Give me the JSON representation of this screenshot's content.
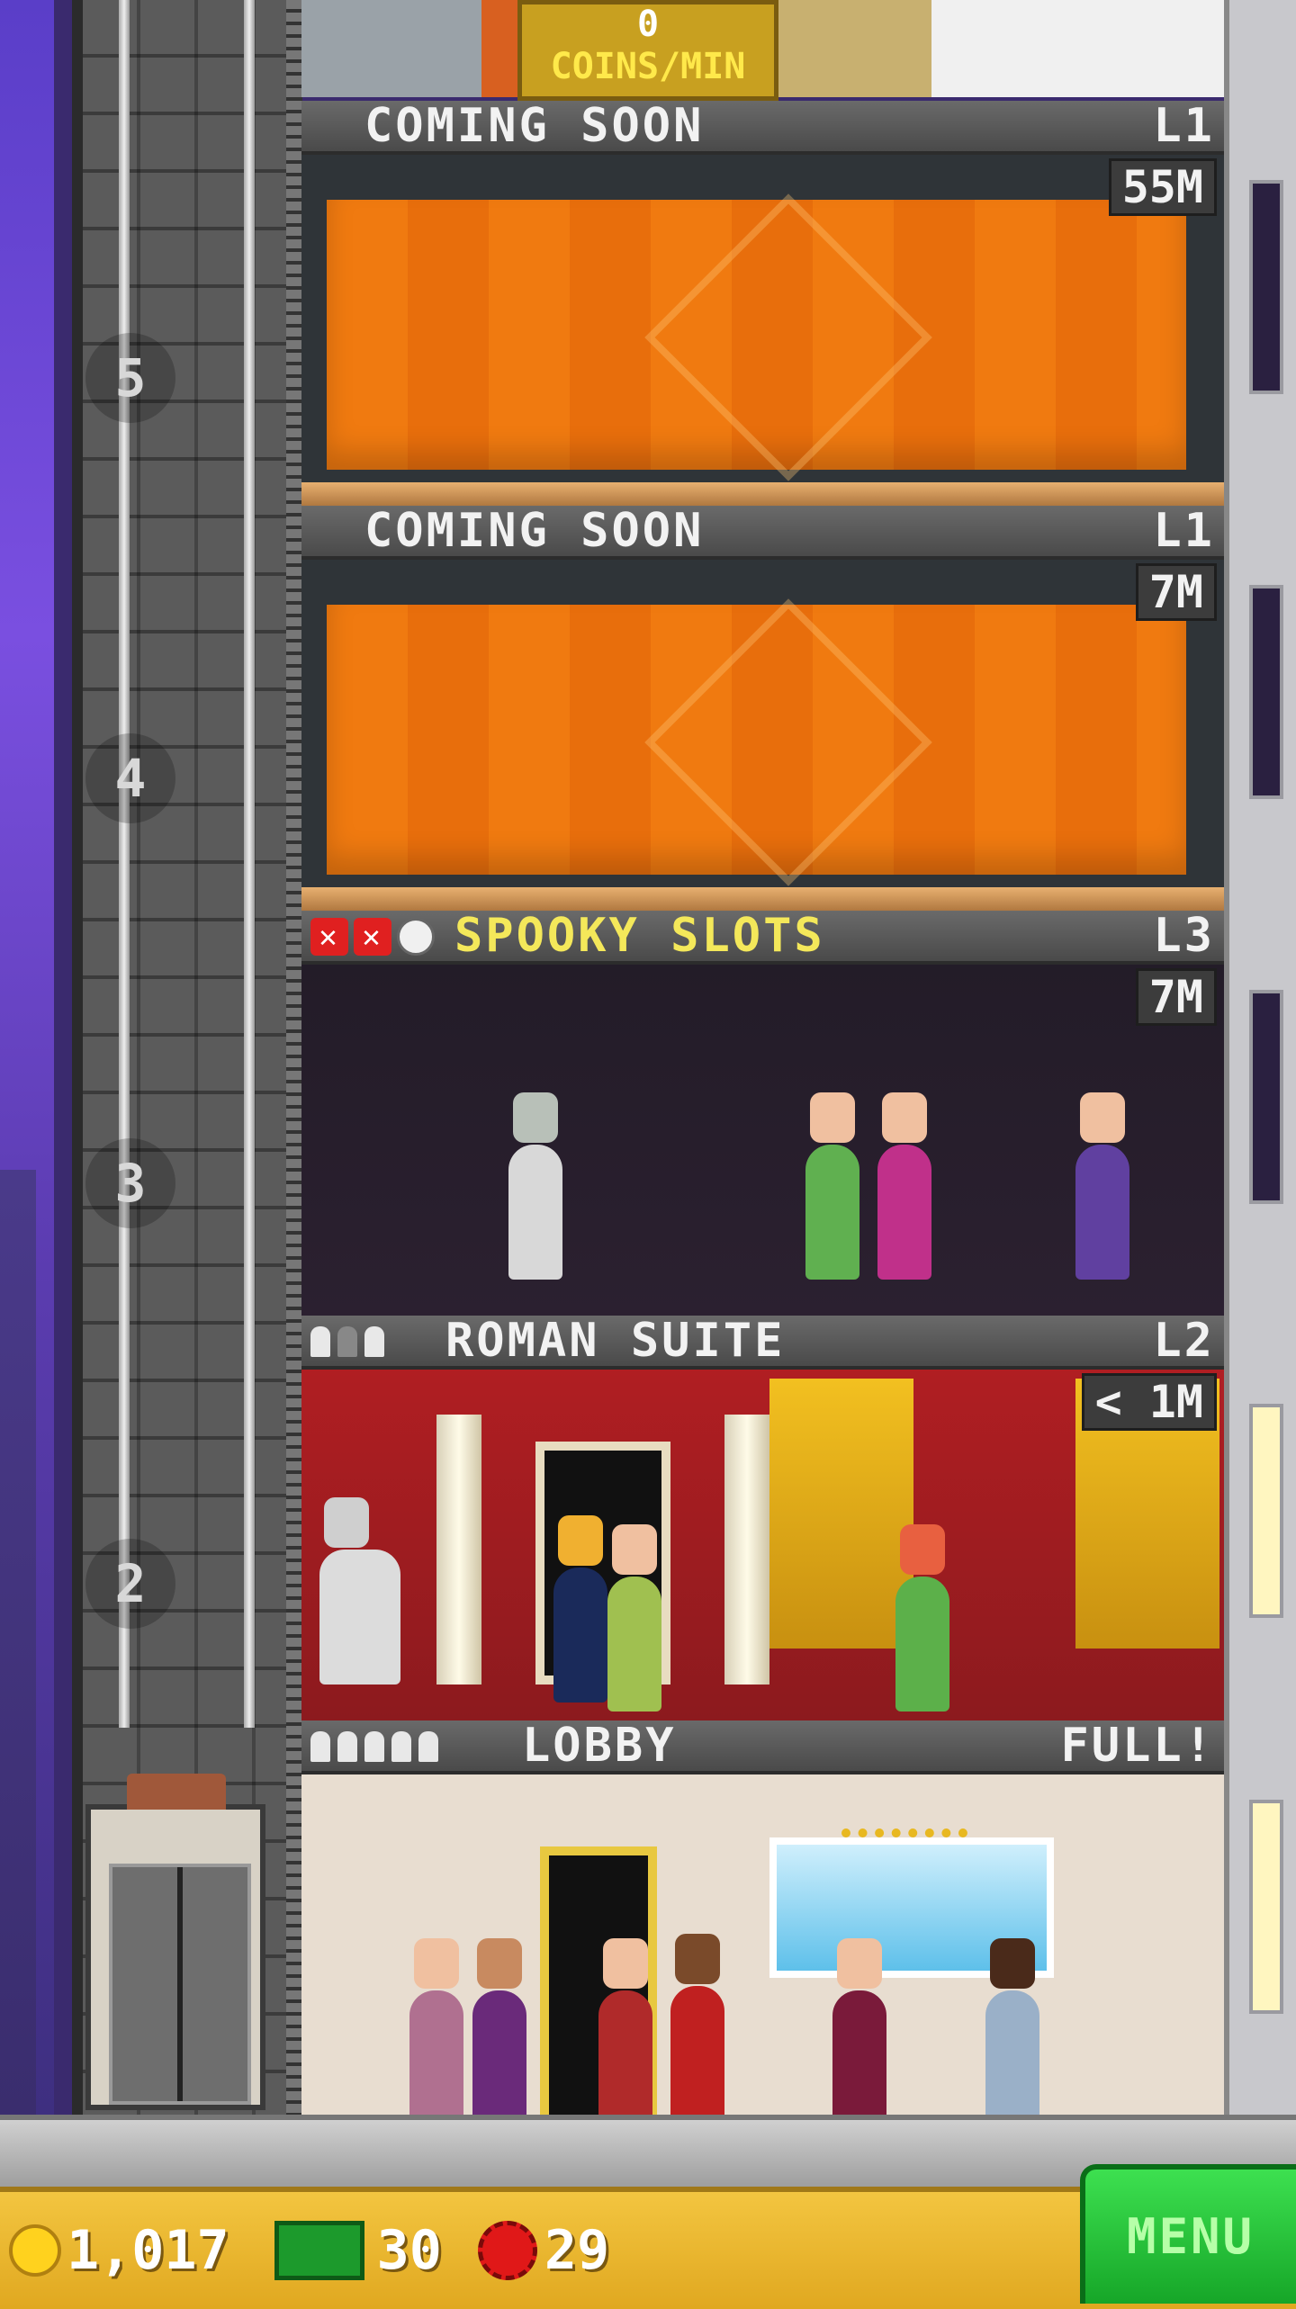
{
  "top_floor": {
    "coins_per_min_value": "0",
    "coins_per_min_label": "COINS/MIN"
  },
  "floors": [
    {
      "name": "COMING SOON",
      "level": "L1",
      "timer": "55M",
      "status": "construction"
    },
    {
      "name": "COMING SOON",
      "level": "L1",
      "timer": "7M",
      "status": "construction"
    },
    {
      "name": "SPOOKY SLOTS",
      "level": "L3",
      "timer": "7M",
      "status": "restock"
    },
    {
      "name": "ROMAN SUITE",
      "level": "L2",
      "timer": "< 1M",
      "status": "residential"
    },
    {
      "name": "LOBBY",
      "level": "FULL!",
      "status": "lobby"
    }
  ],
  "floor_numbers": [
    "5",
    "4",
    "3",
    "2"
  ],
  "hud": {
    "coins": "1,017",
    "bux": "30",
    "tickets": "29",
    "menu_label": "MENU"
  },
  "colors": {
    "construction_curtain": "#f07a10",
    "spooky_title": "#f4e85a",
    "menu_green": "#2cc83e",
    "hud_gold": "#f3c540"
  },
  "icons": [
    "coin-icon",
    "bux-icon",
    "ticket-icon",
    "construction-sign-icon",
    "stop-x-icon",
    "clock-icon",
    "person-icon"
  ]
}
